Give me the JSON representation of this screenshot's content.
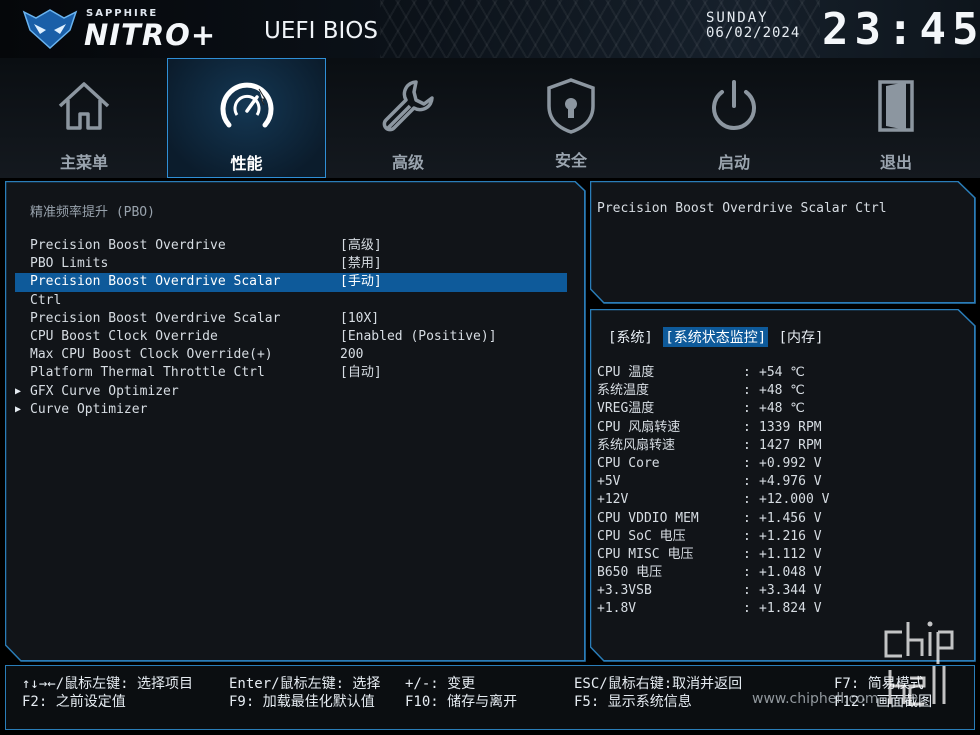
{
  "header": {
    "brand_small": "SAPPHIRE",
    "brand_big": "NITRO+",
    "title": "UEFI BIOS",
    "day": "SUNDAY",
    "date": "06/02/2024",
    "time": "23:45"
  },
  "nav": [
    {
      "label": "主菜单",
      "icon": "home-icon"
    },
    {
      "label": "性能",
      "icon": "speedometer-icon"
    },
    {
      "label": "高级",
      "icon": "wrench-icon"
    },
    {
      "label": "安全",
      "icon": "shield-lock-icon"
    },
    {
      "label": "启动",
      "icon": "power-icon"
    },
    {
      "label": "退出",
      "icon": "exit-door-icon"
    }
  ],
  "main": {
    "section_title": "精准频率提升 (PBO)",
    "items": [
      {
        "label": "Precision Boost Overdrive",
        "value": "[高级]"
      },
      {
        "label": "PBO Limits",
        "value": "[禁用]"
      },
      {
        "label": "Precision Boost Overdrive Scalar",
        "value": "[手动]"
      },
      {
        "label": "Ctrl",
        "value": ""
      },
      {
        "label": "Precision Boost Overdrive Scalar",
        "value": "[10X]"
      },
      {
        "label": "CPU Boost Clock Override",
        "value": "[Enabled (Positive)]"
      },
      {
        "label": "Max CPU Boost Clock Override(+)",
        "value": "200"
      },
      {
        "label": "Platform Thermal Throttle Ctrl",
        "value": "[自动]"
      },
      {
        "label": "GFX Curve Optimizer",
        "value": ""
      },
      {
        "label": "Curve Optimizer",
        "value": ""
      }
    ]
  },
  "help": {
    "text": "Precision Boost Overdrive Scalar Ctrl"
  },
  "monitor": {
    "tabs": [
      "[系统]",
      "[系统状态监控]",
      "[内存]"
    ],
    "rows": [
      {
        "name": "CPU 温度",
        "value": "+54 ℃"
      },
      {
        "name": "系统温度",
        "value": "+48 ℃"
      },
      {
        "name": "VREG温度",
        "value": "+48 ℃"
      },
      {
        "name": "CPU 风扇转速",
        "value": "1339 RPM"
      },
      {
        "name": "系统风扇转速",
        "value": "1427 RPM"
      },
      {
        "name": "CPU Core",
        "value": "+0.992 V"
      },
      {
        "name": "+5V",
        "value": "+4.976 V"
      },
      {
        "name": "+12V",
        "value": "+12.000 V"
      },
      {
        "name": "CPU VDDIO MEM",
        "value": "+1.456 V"
      },
      {
        "name": "CPU SoC 电压",
        "value": "+1.216 V"
      },
      {
        "name": "CPU MISC 电压",
        "value": "+1.112 V"
      },
      {
        "name": "B650 电压",
        "value": "+1.048 V"
      },
      {
        "name": "+3.3VSB",
        "value": "+3.344 V"
      },
      {
        "name": "+1.8V",
        "value": "+1.824 V"
      }
    ],
    "colon": ":"
  },
  "footer": {
    "h1": "↑↓→←/鼠标左键: 选择项目",
    "h2": "F2: 之前设定值",
    "h3": "Enter/鼠标左键: 选择",
    "h4": "F9: 加载最佳化默认值",
    "h5": "+/-: 变更",
    "h6": "F10: 储存与离开",
    "h7": "ESC/鼠标右键:取消并返回",
    "h8": "F5: 显示系统信息",
    "h9": "F7: 简易模式",
    "h10": "F12: 画面截图"
  },
  "watermark": {
    "url": "www.chiphell.com"
  },
  "colors": {
    "accent": "#2a7db8",
    "highlight": "#0e5a9a"
  }
}
